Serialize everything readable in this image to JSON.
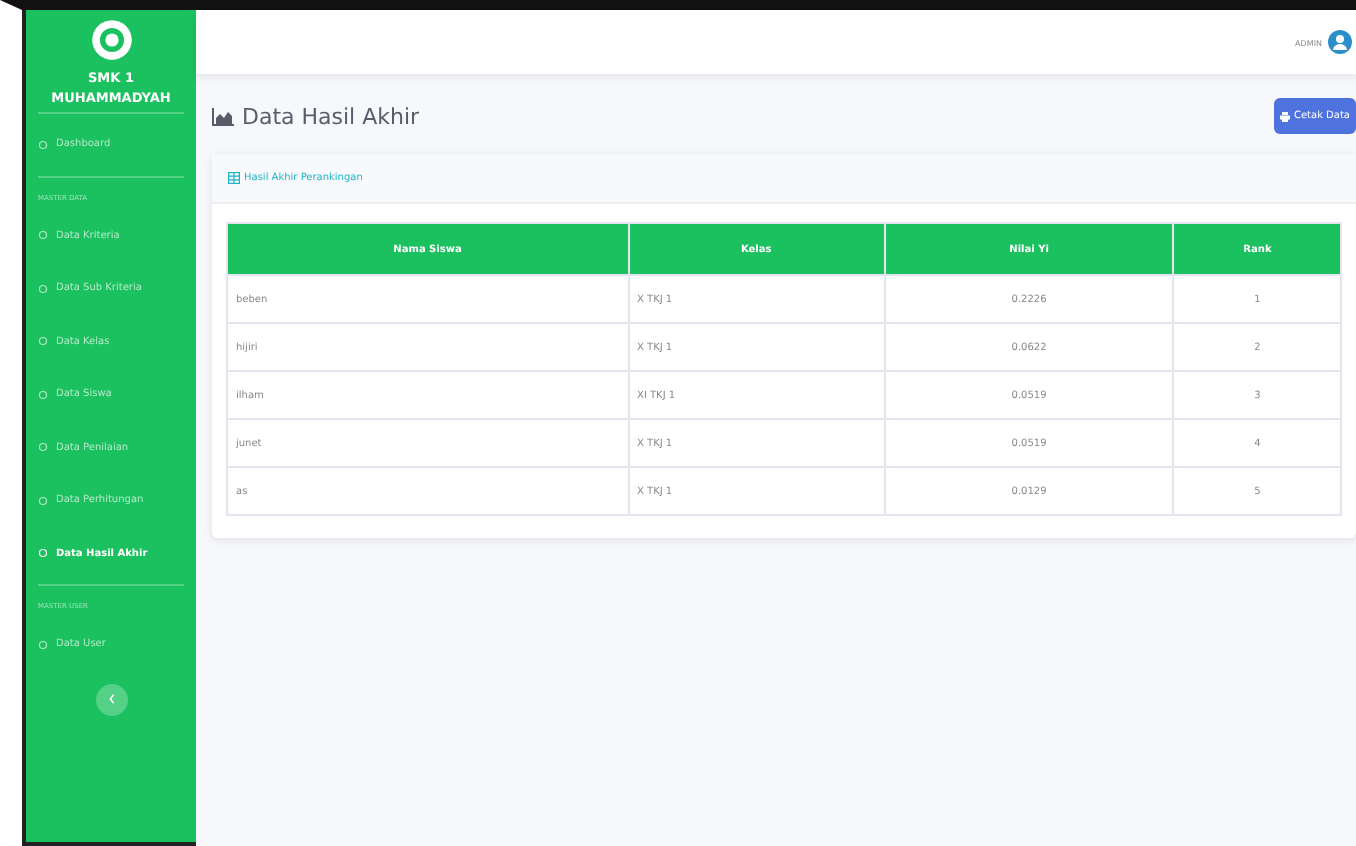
{
  "brand": {
    "line1": "SMK 1",
    "line2": "MUHAMMADYAH"
  },
  "sidebar": {
    "items": [
      {
        "kind": "link",
        "label": "Dashboard",
        "selected": false
      },
      {
        "kind": "divider"
      },
      {
        "kind": "heading",
        "label": "MASTER DATA"
      },
      {
        "kind": "link",
        "label": "Data Kriteria",
        "selected": false
      },
      {
        "kind": "link",
        "label": "Data Sub Kriteria",
        "selected": false
      },
      {
        "kind": "link",
        "label": "Data Kelas",
        "selected": false
      },
      {
        "kind": "link",
        "label": "Data Siswa",
        "selected": false
      },
      {
        "kind": "link",
        "label": "Data Penilaian",
        "selected": false
      },
      {
        "kind": "link",
        "label": "Data Perhitungan",
        "selected": false
      },
      {
        "kind": "link",
        "label": "Data Hasil Akhir",
        "selected": true
      },
      {
        "kind": "divider"
      },
      {
        "kind": "heading",
        "label": "MASTER USER"
      },
      {
        "kind": "link",
        "label": "Data User",
        "selected": false
      }
    ]
  },
  "topbar": {
    "user": "ADMIN"
  },
  "page": {
    "title": "Data Hasil Akhir",
    "button": "Cetak Data"
  },
  "card": {
    "title": "Hasil Akhir Perankingan"
  },
  "table": {
    "columns": [
      "Nama Siswa",
      "Kelas",
      "Nilai Yi",
      "Rank"
    ],
    "rows": [
      [
        "beben",
        "X TKJ 1",
        "0.2226",
        "1"
      ],
      [
        "hijiri",
        "X TKJ 1",
        "0.0622",
        "2"
      ],
      [
        "ilham",
        "XI TKJ 1",
        "0.0519",
        "3"
      ],
      [
        "junet",
        "X TKJ 1",
        "0.0519",
        "4"
      ],
      [
        "as",
        "X TKJ 1",
        "0.0129",
        "5"
      ]
    ]
  }
}
